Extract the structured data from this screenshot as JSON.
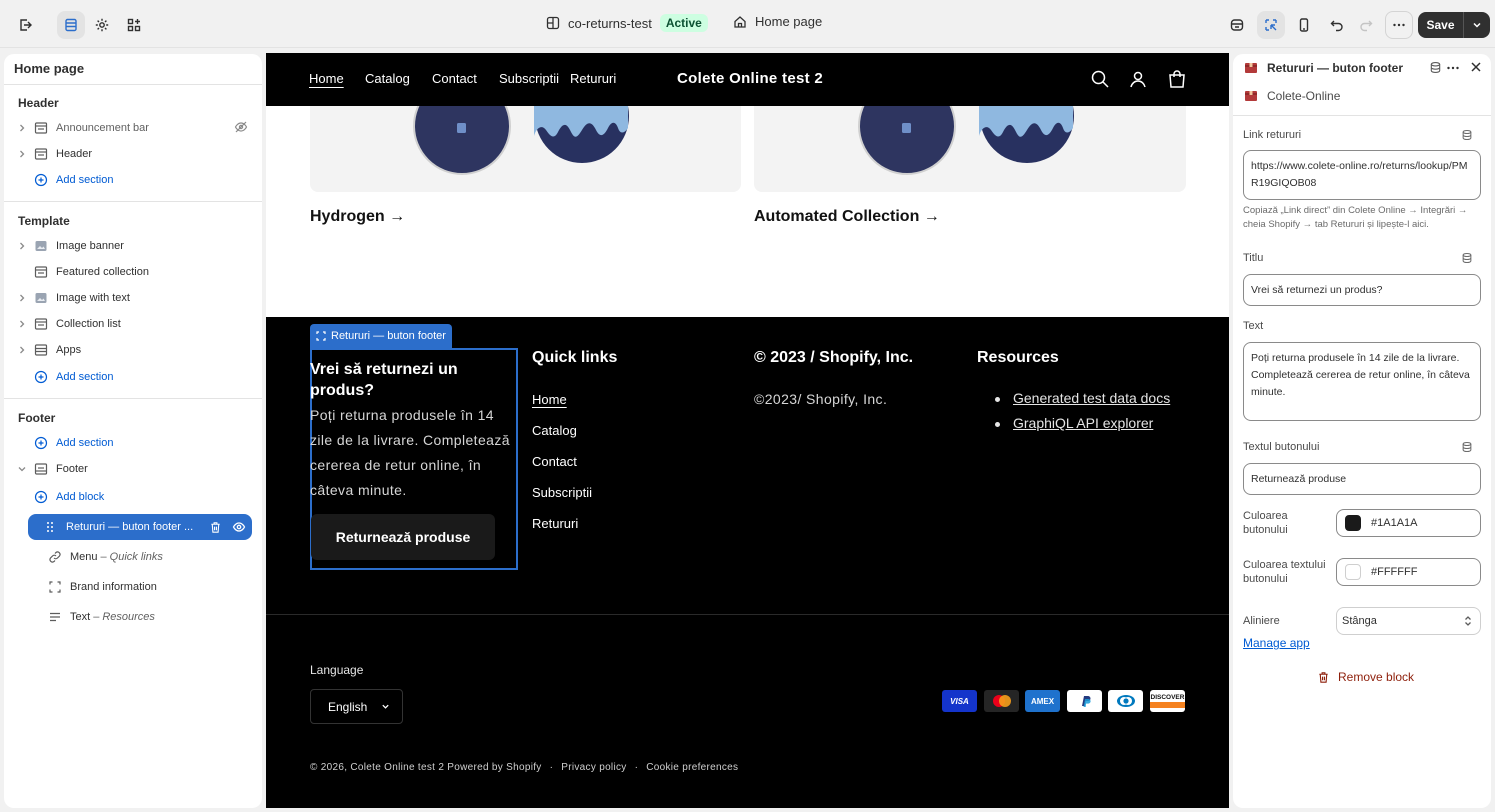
{
  "topbar": {
    "theme_name": "co-returns-test",
    "theme_status": "Active",
    "page_selector": "Home page",
    "save_label": "Save"
  },
  "sidebar": {
    "title": "Home page",
    "groups": {
      "header": "Header",
      "template": "Template",
      "footer": "Footer"
    },
    "header_items": [
      "Announcement bar",
      "Header"
    ],
    "template_items": [
      "Image banner",
      "Featured collection",
      "Image with text",
      "Collection list",
      "Apps"
    ],
    "add_section": "Add section",
    "footer_section": "Footer",
    "add_block": "Add block",
    "selected_block": "Retururi — buton footer ...",
    "footer_blocks": [
      {
        "label": "Menu",
        "detail": "Quick links"
      },
      {
        "label": "Brand information",
        "detail": ""
      },
      {
        "label": "Text",
        "detail": "Resources"
      }
    ]
  },
  "preview": {
    "nav_links": [
      "Home",
      "Catalog",
      "Contact",
      "Subscriptii",
      "Retururi"
    ],
    "store_name": "Colete Online test 2",
    "collections": [
      "Hydrogen →",
      "Automated Collection →"
    ],
    "selected_label": "Retururi — buton footer",
    "returns": {
      "title": "Vrei să returnezi un produs?",
      "text": "Poți returna produsele în 14 zile de la livrare. Completează cererea de retur online, în câteva minute.",
      "button": "Returnează produse"
    },
    "quick_links_title": "Quick links",
    "quick_links": [
      "Home",
      "Catalog",
      "Contact",
      "Subscriptii",
      "Retururi"
    ],
    "brand_title": "© 2023 / Shopify, Inc.",
    "brand_text": "©2023/ Shopify, Inc.",
    "resources_title": "Resources",
    "resources": [
      "Generated test data docs",
      "GraphiQL API explorer"
    ],
    "language_label": "Language",
    "language_value": "English",
    "payments": [
      "VISA",
      "MC",
      "AMEX",
      "PayPal",
      "Diners",
      "DISCOVER"
    ],
    "bottom": [
      "© 2026, Colete Online test 2 Powered by Shopify",
      "·",
      "Privacy policy",
      "·",
      "Cookie preferences"
    ]
  },
  "panel": {
    "title": "Retururi — buton footer",
    "app_name": "Colete-Online",
    "link_label": "Link retururi",
    "link_value": "https://www.colete-online.ro/returns/lookup/PMR19GIQOB08",
    "link_help": "Copiază „Link direct” din Colete Online → Integrări → cheia Shopify → tab Retururi și lipește-l aici.",
    "title_label": "Titlu",
    "title_value": "Vrei să returnezi un produs?",
    "text_label": "Text",
    "text_value": "Poți returna produsele în 14 zile de la livrare. Completează cererea de retur online, în câteva minute.",
    "button_text_label": "Textul butonului",
    "button_text_value": "Returnează produse",
    "button_color_label": "Culoarea butonului",
    "button_color_value": "#1A1A1A",
    "button_text_color_label": "Culoarea textului butonului",
    "button_text_color_value": "#FFFFFF",
    "alignment_label": "Aliniere",
    "alignment_value": "Stânga",
    "manage_app": "Manage app",
    "remove_block": "Remove block"
  }
}
